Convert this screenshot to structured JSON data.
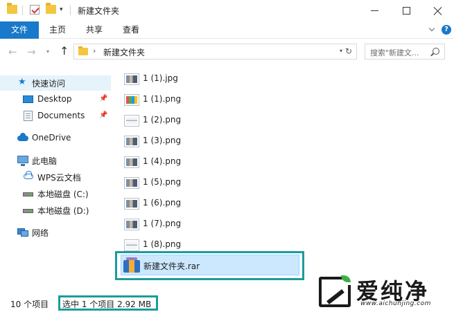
{
  "window": {
    "title": "新建文件夹"
  },
  "ribbon": {
    "tabs": [
      {
        "label": "文件"
      },
      {
        "label": "主页"
      },
      {
        "label": "共享"
      },
      {
        "label": "查看"
      }
    ]
  },
  "address": {
    "path": "新建文件夹",
    "search_placeholder": "搜索\"新建文..."
  },
  "sidebar": {
    "items": [
      {
        "label": "快速访问",
        "icon": "star-icon",
        "selected": true
      },
      {
        "label": "Desktop",
        "icon": "desktop-icon",
        "pinned": true
      },
      {
        "label": "Documents",
        "icon": "documents-icon",
        "pinned": true
      },
      {
        "label": "OneDrive",
        "icon": "onedrive-cloud-icon"
      },
      {
        "label": "此电脑",
        "icon": "pc-icon"
      },
      {
        "label": "WPS云文档",
        "icon": "wps-cloud-icon"
      },
      {
        "label": "本地磁盘 (C:)",
        "icon": "drive-icon"
      },
      {
        "label": "本地磁盘 (D:)",
        "icon": "drive-icon"
      },
      {
        "label": "网络",
        "icon": "network-icon"
      }
    ]
  },
  "files": [
    {
      "name": "1 (1).jpg"
    },
    {
      "name": "1 (1).png"
    },
    {
      "name": "1 (2).png"
    },
    {
      "name": "1 (3).png"
    },
    {
      "name": "1 (4).png"
    },
    {
      "name": "1 (5).png"
    },
    {
      "name": "1 (6).png"
    },
    {
      "name": "1 (7).png"
    },
    {
      "name": "1 (8).png"
    },
    {
      "name": "新建文件夹.rar",
      "selected": true
    }
  ],
  "status": {
    "item_count": "10 个项目",
    "selection": "选中 1 个项目  2.92 MB"
  },
  "watermark": {
    "brand": "爱纯净",
    "url": "www.aichunjing.com"
  },
  "colors": {
    "accent": "#1979ca",
    "highlight_frame": "#1a9c9c",
    "selection_bg": "#cce8ff"
  }
}
